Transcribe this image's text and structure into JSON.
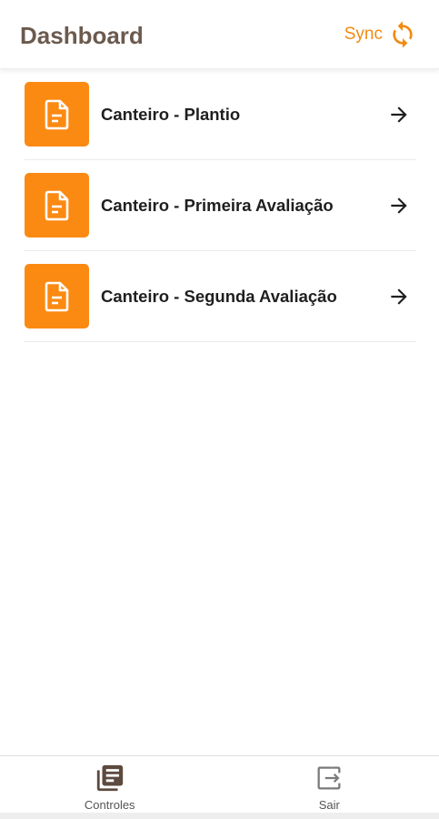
{
  "header": {
    "title": "Dashboard",
    "sync_label": "Sync",
    "sync_icon": "sync-icon"
  },
  "items": [
    {
      "label": "Canteiro - Plantio",
      "icon": "document-icon",
      "action_icon": "arrow-right-icon"
    },
    {
      "label": "Canteiro - Primeira Avaliação",
      "icon": "document-icon",
      "action_icon": "arrow-right-icon"
    },
    {
      "label": "Canteiro - Segunda Avaliação",
      "icon": "document-icon",
      "action_icon": "arrow-right-icon"
    }
  ],
  "bottom_nav": [
    {
      "label": "Controles",
      "icon": "library-icon"
    },
    {
      "label": "Sair",
      "icon": "exit-icon"
    }
  ],
  "colors": {
    "accent": "#fb8a12",
    "sync": "#f28a10",
    "title": "#6b5a4e",
    "nav_icon": "#5c4a3e",
    "text": "#1f1f1f"
  }
}
